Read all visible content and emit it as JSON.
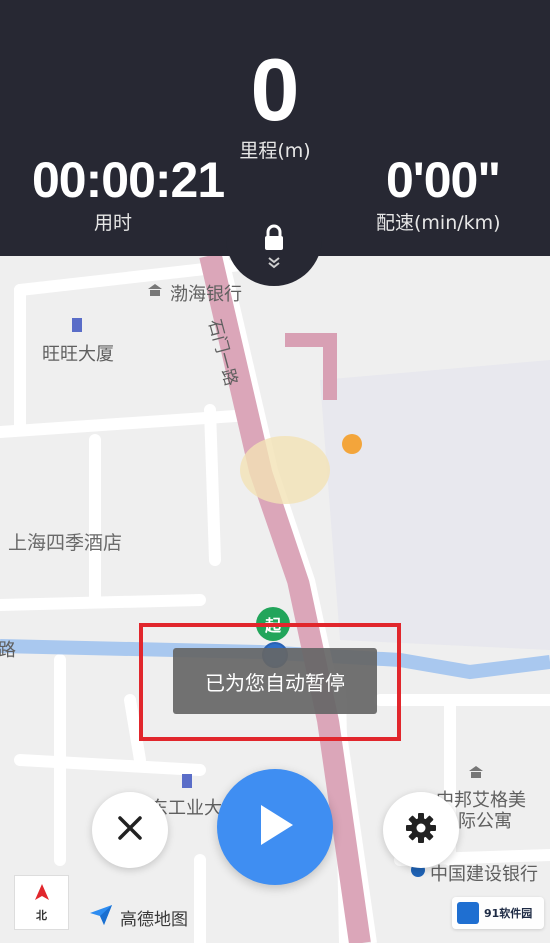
{
  "stats": {
    "distance_value": "0",
    "distance_label": "里程(m)",
    "time_value": "00:00:21",
    "time_label": "用时",
    "pace_value": "0'00\"",
    "pace_label": "配速(min/km)"
  },
  "map": {
    "labels": {
      "bohai_bank": "渤海银行",
      "wangwang": "旺旺大厦",
      "road_shimen": "石门一路",
      "four_seasons": "上海四季酒店",
      "road_left": "南路",
      "industry": "东工业大",
      "bangbang_line1": "中邦艾格美",
      "bangbang_line2": "际公寓",
      "ccb": "中国建设银行"
    },
    "start_marker": "起",
    "north_label": "北",
    "brand": "高德地图"
  },
  "toast": {
    "message": "已为您自动暂停"
  },
  "watermark": {
    "text": "91软件园"
  },
  "colors": {
    "panel": "#272833",
    "play": "#3f8ef2",
    "highlight": "#e1262c",
    "rail": "#d79ab0",
    "road_blue": "#a9c8ef"
  },
  "icons": {
    "lock": "lock-icon",
    "collapse": "chevron-double-down-icon",
    "close": "close-icon",
    "play": "play-icon",
    "settings": "gear-icon",
    "north": "north-arrow-icon"
  }
}
